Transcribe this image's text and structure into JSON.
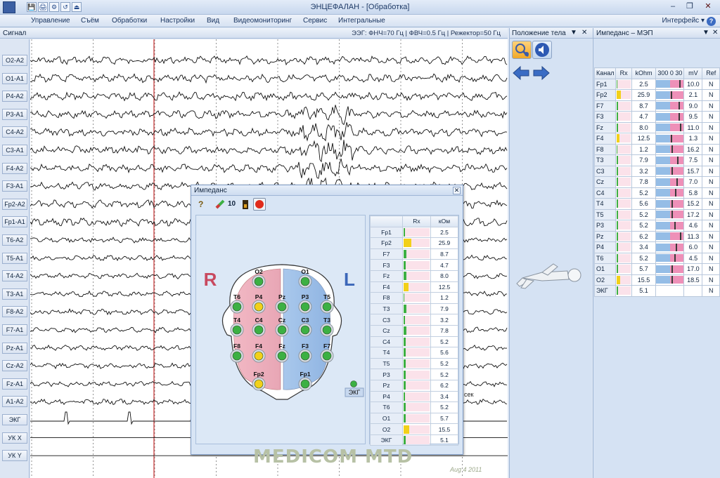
{
  "window": {
    "title": "ЭНЦЕФАЛАН - [Обработка]",
    "controls": [
      "–",
      "❐",
      "✕"
    ]
  },
  "quick_access": [
    "💾",
    "🖨",
    "⚙",
    "↺",
    "⏏"
  ],
  "menu": {
    "items": [
      "Управление",
      "Съём",
      "Обработки",
      "Настройки",
      "Вид",
      "Видеомониторинг",
      "Сервис",
      "Интегральные"
    ],
    "interface_label": "Интерфейс",
    "help": "?"
  },
  "signal_panel": {
    "title": "Сигнал",
    "params": "ЭЭГ: ФНЧ=70 Гц | ФВЧ=0.5 Гц | Режектор=50 Гц",
    "channels": [
      "O2-A2",
      "O1-A1",
      "P4-A2",
      "P3-A1",
      "C4-A2",
      "C3-A1",
      "F4-A2",
      "F3-A1",
      "Fp2-A2",
      "Fp1-A1",
      "T6-A2",
      "T5-A1",
      "T4-A2",
      "T3-A1",
      "F8-A2",
      "F7-A1",
      "Pz-A1",
      "Cz-A2",
      "Fz-A1",
      "A1-A2",
      "ЭКГ",
      "УК X",
      "УК Y"
    ],
    "annotation": "сек"
  },
  "body_panel": {
    "title": "Положение тела",
    "controls": [
      "▼",
      "✕"
    ]
  },
  "impedance_panel": {
    "title": "Импеданс – МЭП",
    "controls": [
      "▼",
      "✕"
    ],
    "columns": [
      "Канал",
      "Rx",
      "kOhm",
      "300 0 30",
      "mV",
      "Ref"
    ],
    "rows": [
      {
        "name": "Fp1",
        "kohm": "2.5",
        "mv": "10.0",
        "ref": "N",
        "imp_frac": 0.05,
        "imp_color": "#3cb043",
        "mv_pos": 0.83
      },
      {
        "name": "Fp2",
        "kohm": "25.9",
        "mv": "2.1",
        "ref": "N",
        "imp_frac": 0.3,
        "imp_color": "#f2d01a",
        "mv_pos": 0.53
      },
      {
        "name": "F7",
        "kohm": "8.7",
        "mv": "9.0",
        "ref": "N",
        "imp_frac": 0.1,
        "imp_color": "#3cb043",
        "mv_pos": 0.8
      },
      {
        "name": "F3",
        "kohm": "4.7",
        "mv": "9.5",
        "ref": "N",
        "imp_frac": 0.07,
        "imp_color": "#3cb043",
        "mv_pos": 0.82
      },
      {
        "name": "Fz",
        "kohm": "8.0",
        "mv": "11.0",
        "ref": "N",
        "imp_frac": 0.1,
        "imp_color": "#3cb043",
        "mv_pos": 0.86
      },
      {
        "name": "F4",
        "kohm": "12.5",
        "mv": "1.3",
        "ref": "N",
        "imp_frac": 0.2,
        "imp_color": "#f2d01a",
        "mv_pos": 0.52
      },
      {
        "name": "F8",
        "kohm": "1.2",
        "mv": "16.2",
        "ref": "N",
        "imp_frac": 0.04,
        "imp_color": "#3cb043",
        "mv_pos": 0.55
      },
      {
        "name": "T3",
        "kohm": "7.9",
        "mv": "7.5",
        "ref": "N",
        "imp_frac": 0.1,
        "imp_color": "#3cb043",
        "mv_pos": 0.75
      },
      {
        "name": "C3",
        "kohm": "3.2",
        "mv": "15.7",
        "ref": "N",
        "imp_frac": 0.06,
        "imp_color": "#3cb043",
        "mv_pos": 0.55
      },
      {
        "name": "Cz",
        "kohm": "7.8",
        "mv": "7.0",
        "ref": "N",
        "imp_frac": 0.1,
        "imp_color": "#3cb043",
        "mv_pos": 0.73
      },
      {
        "name": "C4",
        "kohm": "5.2",
        "mv": "5.8",
        "ref": "N",
        "imp_frac": 0.08,
        "imp_color": "#3cb043",
        "mv_pos": 0.69
      },
      {
        "name": "T4",
        "kohm": "5.6",
        "mv": "15.2",
        "ref": "N",
        "imp_frac": 0.08,
        "imp_color": "#3cb043",
        "mv_pos": 0.55
      },
      {
        "name": "T5",
        "kohm": "5.2",
        "mv": "17.2",
        "ref": "N",
        "imp_frac": 0.08,
        "imp_color": "#3cb043",
        "mv_pos": 0.55
      },
      {
        "name": "P3",
        "kohm": "5.2",
        "mv": "4.6",
        "ref": "N",
        "imp_frac": 0.08,
        "imp_color": "#3cb043",
        "mv_pos": 0.65
      },
      {
        "name": "Pz",
        "kohm": "6.2",
        "mv": "11.3",
        "ref": "N",
        "imp_frac": 0.09,
        "imp_color": "#3cb043",
        "mv_pos": 0.87
      },
      {
        "name": "P4",
        "kohm": "3.4",
        "mv": "6.0",
        "ref": "N",
        "imp_frac": 0.06,
        "imp_color": "#3cb043",
        "mv_pos": 0.7
      },
      {
        "name": "T6",
        "kohm": "5.2",
        "mv": "4.5",
        "ref": "N",
        "imp_frac": 0.08,
        "imp_color": "#3cb043",
        "mv_pos": 0.65
      },
      {
        "name": "O1",
        "kohm": "5.7",
        "mv": "17.0",
        "ref": "N",
        "imp_frac": 0.08,
        "imp_color": "#3cb043",
        "mv_pos": 0.55
      },
      {
        "name": "O2",
        "kohm": "15.5",
        "mv": "18.5",
        "ref": "N",
        "imp_frac": 0.22,
        "imp_color": "#f2d01a",
        "mv_pos": 0.55
      },
      {
        "name": "ЭКГ",
        "kohm": "5.1",
        "mv": "",
        "ref": "N",
        "imp_frac": 0.08,
        "imp_color": "#3cb043",
        "mv_pos": null
      }
    ]
  },
  "impedance_dialog": {
    "title": "Импеданс",
    "close": "✕",
    "toolbar": {
      "help": "?",
      "threshold": "10"
    },
    "head_labels": {
      "right": "R",
      "left": "L"
    },
    "ekg_label": "ЭКГ",
    "columns": [
      "",
      "Rx",
      "кОм"
    ],
    "rows": [
      {
        "name": "Fp1",
        "kom": "2.5",
        "imp_frac": 0.05,
        "imp_color": "#3cb043"
      },
      {
        "name": "Fp2",
        "kom": "25.9",
        "imp_frac": 0.3,
        "imp_color": "#f2d01a"
      },
      {
        "name": "F7",
        "kom": "8.7",
        "imp_frac": 0.1,
        "imp_color": "#3cb043"
      },
      {
        "name": "F3",
        "kom": "4.7",
        "imp_frac": 0.07,
        "imp_color": "#3cb043"
      },
      {
        "name": "Fz",
        "kom": "8.0",
        "imp_frac": 0.1,
        "imp_color": "#3cb043"
      },
      {
        "name": "F4",
        "kom": "12.5",
        "imp_frac": 0.2,
        "imp_color": "#f2d01a"
      },
      {
        "name": "F8",
        "kom": "1.2",
        "imp_frac": 0.04,
        "imp_color": "#3cb043"
      },
      {
        "name": "T3",
        "kom": "7.9",
        "imp_frac": 0.1,
        "imp_color": "#3cb043"
      },
      {
        "name": "C3",
        "kom": "3.2",
        "imp_frac": 0.06,
        "imp_color": "#3cb043"
      },
      {
        "name": "Cz",
        "kom": "7.8",
        "imp_frac": 0.1,
        "imp_color": "#3cb043"
      },
      {
        "name": "C4",
        "kom": "5.2",
        "imp_frac": 0.08,
        "imp_color": "#3cb043"
      },
      {
        "name": "T4",
        "kom": "5.6",
        "imp_frac": 0.08,
        "imp_color": "#3cb043"
      },
      {
        "name": "T5",
        "kom": "5.2",
        "imp_frac": 0.08,
        "imp_color": "#3cb043"
      },
      {
        "name": "P3",
        "kom": "5.2",
        "imp_frac": 0.08,
        "imp_color": "#3cb043"
      },
      {
        "name": "Pz",
        "kom": "6.2",
        "imp_frac": 0.09,
        "imp_color": "#3cb043"
      },
      {
        "name": "P4",
        "kom": "3.4",
        "imp_frac": 0.06,
        "imp_color": "#3cb043"
      },
      {
        "name": "T6",
        "kom": "5.2",
        "imp_frac": 0.08,
        "imp_color": "#3cb043"
      },
      {
        "name": "O1",
        "kom": "5.7",
        "imp_frac": 0.08,
        "imp_color": "#3cb043"
      },
      {
        "name": "O2",
        "kom": "15.5",
        "imp_frac": 0.22,
        "imp_color": "#f2d01a"
      },
      {
        "name": "ЭКГ",
        "kom": "5.1",
        "imp_frac": 0.08,
        "imp_color": "#3cb043"
      }
    ],
    "electrodes": [
      {
        "name": "O2",
        "status": "good"
      },
      {
        "name": "O1",
        "status": "good"
      },
      {
        "name": "T6",
        "status": "good"
      },
      {
        "name": "P4",
        "status": "warn"
      },
      {
        "name": "Pz",
        "status": "good"
      },
      {
        "name": "P3",
        "status": "good"
      },
      {
        "name": "T5",
        "status": "good"
      },
      {
        "name": "T4",
        "status": "good"
      },
      {
        "name": "C4",
        "status": "good"
      },
      {
        "name": "Cz",
        "status": "good"
      },
      {
        "name": "C3",
        "status": "good"
      },
      {
        "name": "T3",
        "status": "good"
      },
      {
        "name": "F8",
        "status": "good"
      },
      {
        "name": "F4",
        "status": "warn"
      },
      {
        "name": "Fz",
        "status": "good"
      },
      {
        "name": "F3",
        "status": "good"
      },
      {
        "name": "F7",
        "status": "good"
      },
      {
        "name": "Fp2",
        "status": "warn"
      },
      {
        "name": "Fp1",
        "status": "good"
      }
    ]
  },
  "watermark": {
    "text": "MEDICOM MTD",
    "date": "Aug 4 2011"
  },
  "colors": {
    "good": "#3cb043",
    "warn": "#f2d01a",
    "cursor": "#c43030",
    "trace": "#111111"
  }
}
